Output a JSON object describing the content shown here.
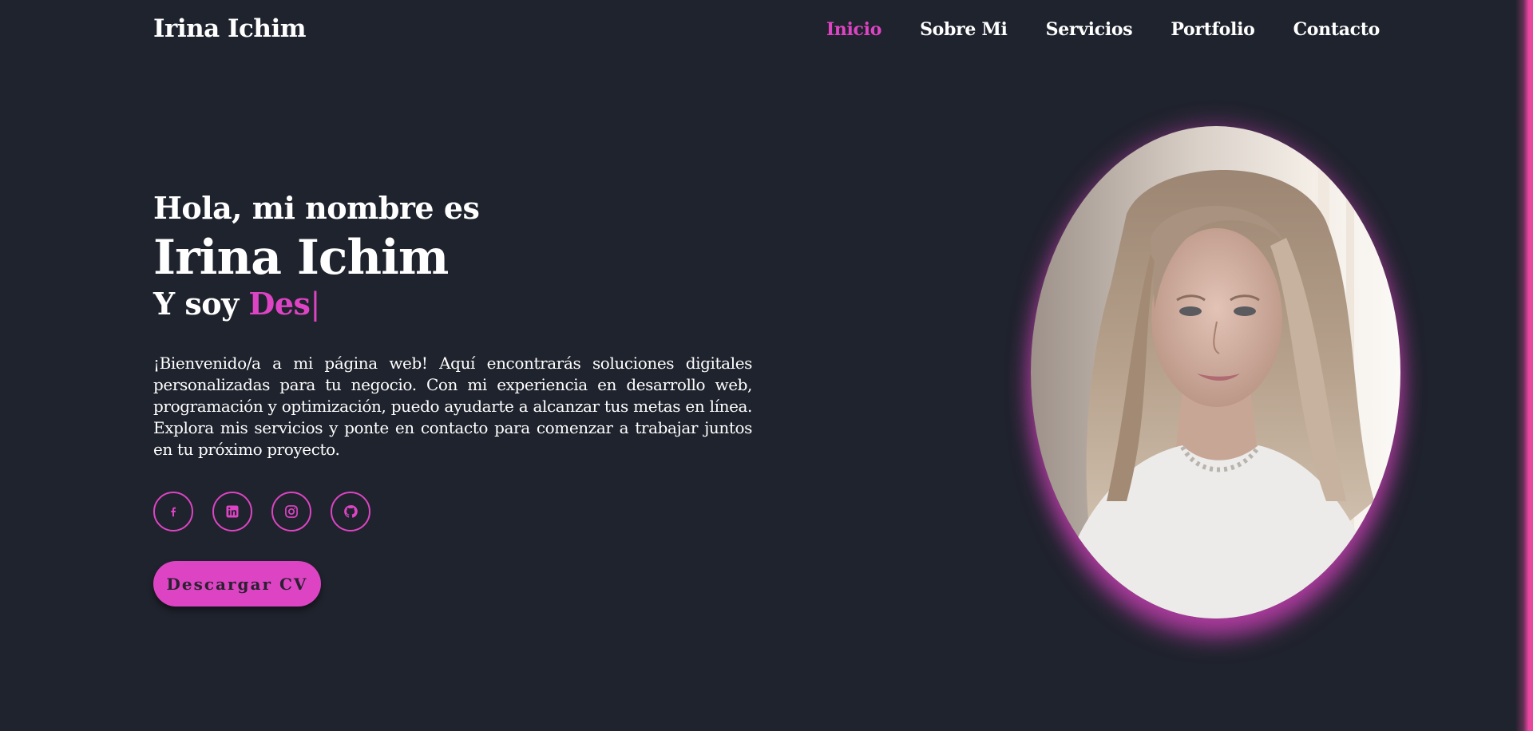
{
  "header": {
    "logo": "Irina Ichim",
    "nav": [
      {
        "label": "Inicio",
        "active": true
      },
      {
        "label": "Sobre Mi",
        "active": false
      },
      {
        "label": "Servicios",
        "active": false
      },
      {
        "label": "Portfolio",
        "active": false
      },
      {
        "label": "Contacto",
        "active": false
      }
    ]
  },
  "hero": {
    "greeting": "Hola, mi nombre es",
    "name": "Irina Ichim",
    "role_prefix": "Y soy ",
    "role_typed": "Des",
    "caret": "|",
    "description": "¡Bienvenido/a a mi página web! Aquí encontrarás soluciones digitales personalizadas para tu negocio. Con mi experiencia en desarrollo web, programación y optimización, puedo ayudarte a alcanzar tus metas en línea. Explora mis servicios y ponte en contacto para comenzar a trabajar juntos en tu próximo proyecto.",
    "socials": [
      {
        "icon": "facebook-icon"
      },
      {
        "icon": "linkedin-icon"
      },
      {
        "icon": "instagram-icon"
      },
      {
        "icon": "github-icon"
      }
    ],
    "cv_button": "Descargar CV",
    "photo": "profile-photo"
  },
  "colors": {
    "background": "#1f232d",
    "accent": "#dd44c4",
    "text": "#ffffff"
  }
}
